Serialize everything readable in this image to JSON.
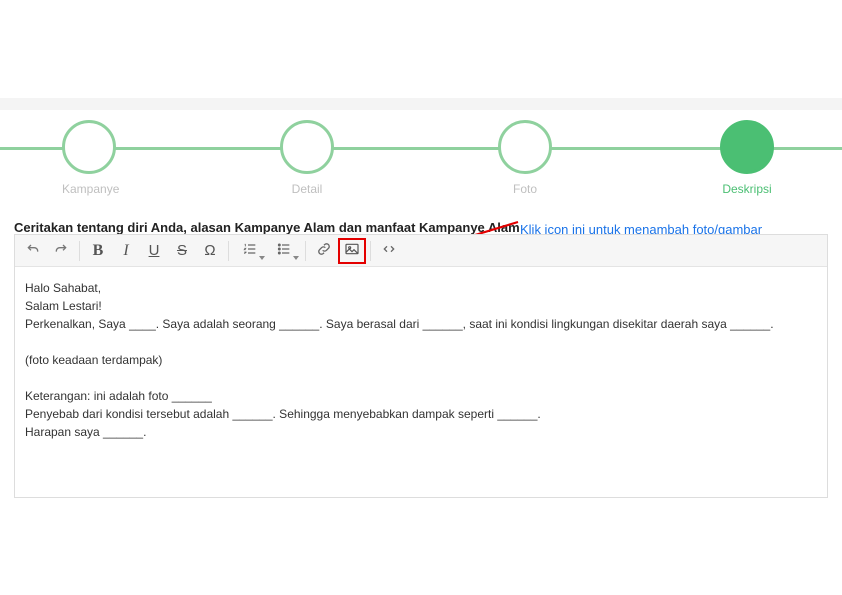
{
  "stepper": {
    "steps": [
      {
        "label": "Kampanye",
        "icon": "map-icon",
        "active": false
      },
      {
        "label": "Detail",
        "icon": "signpost-icon",
        "active": false
      },
      {
        "label": "Foto",
        "icon": "image-icon",
        "active": false
      },
      {
        "label": "Deskripsi",
        "icon": "chat-icon",
        "active": true
      }
    ]
  },
  "heading": "Ceritakan tentang diri Anda, alasan Kampanye Alam dan manfaat Kampanye Alam",
  "annotation": "Klik icon ini untuk menambah foto/gambar",
  "annotation_color": "#1a73e8",
  "highlight_color": "#e40000",
  "accent": "#4bbf73",
  "toolbar": {
    "undo": "↶",
    "redo": "↷",
    "bold": "B",
    "italic": "I",
    "underline": "U",
    "strike": "S",
    "omega": "Ω",
    "link": "🔗",
    "source": "< >"
  },
  "editor_content": "Halo Sahabat,\nSalam Lestari!\nPerkenalkan, Saya ____. Saya adalah seorang ______. Saya berasal dari ______, saat ini kondisi lingkungan disekitar daerah saya ______.\n\n(foto keadaan terdampak)\n\nKeterangan: ini adalah foto ______\nPenyebab dari kondisi tersebut adalah ______. Sehingga menyebabkan dampak seperti ______.\nHarapan saya ______."
}
